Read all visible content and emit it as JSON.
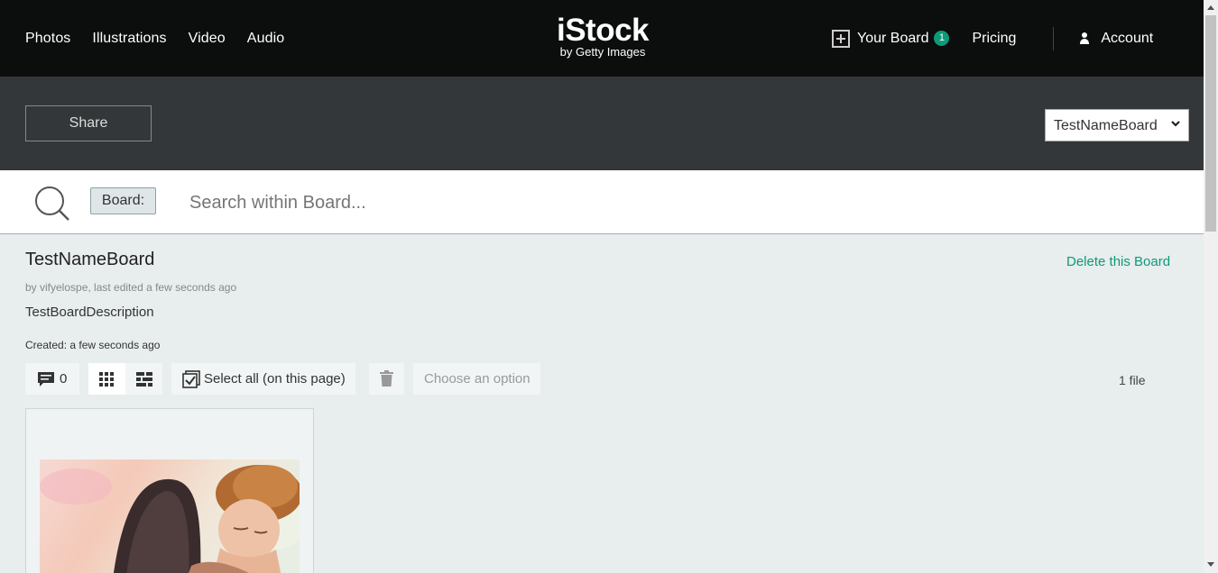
{
  "nav": {
    "photos": "Photos",
    "illustrations": "Illustrations",
    "video": "Video",
    "audio": "Audio",
    "logo_brand": "iStock",
    "logo_sub": "by Getty Images",
    "your_board": "Your Board",
    "board_count": "1",
    "pricing": "Pricing",
    "account": "Account"
  },
  "band": {
    "share_label": "Share",
    "board_select_value": "TestNameBoard"
  },
  "search": {
    "board_tag": "Board:",
    "placeholder": "Search within Board..."
  },
  "board": {
    "title": "TestNameBoard",
    "delete_label": "Delete this Board",
    "byline": "by vifyelospe, last edited a few seconds ago",
    "description": "TestBoardDescription",
    "created": "Created: a few seconds ago"
  },
  "toolbar": {
    "comment_count": "0",
    "select_all": "Select all (on this page)",
    "choose_option": "Choose an option",
    "file_count": "1 file"
  },
  "icons": {
    "search": "search-icon",
    "board": "board-add-icon",
    "user": "user-icon",
    "chevron": "chevron-down-icon",
    "comment": "comment-icon",
    "grid": "grid-view-icon",
    "mosaic": "mosaic-view-icon",
    "select": "select-all-icon",
    "trash": "trash-icon"
  },
  "colors": {
    "accent": "#0c9a78",
    "topnav": "#0c0d0d",
    "band": "#333739"
  }
}
